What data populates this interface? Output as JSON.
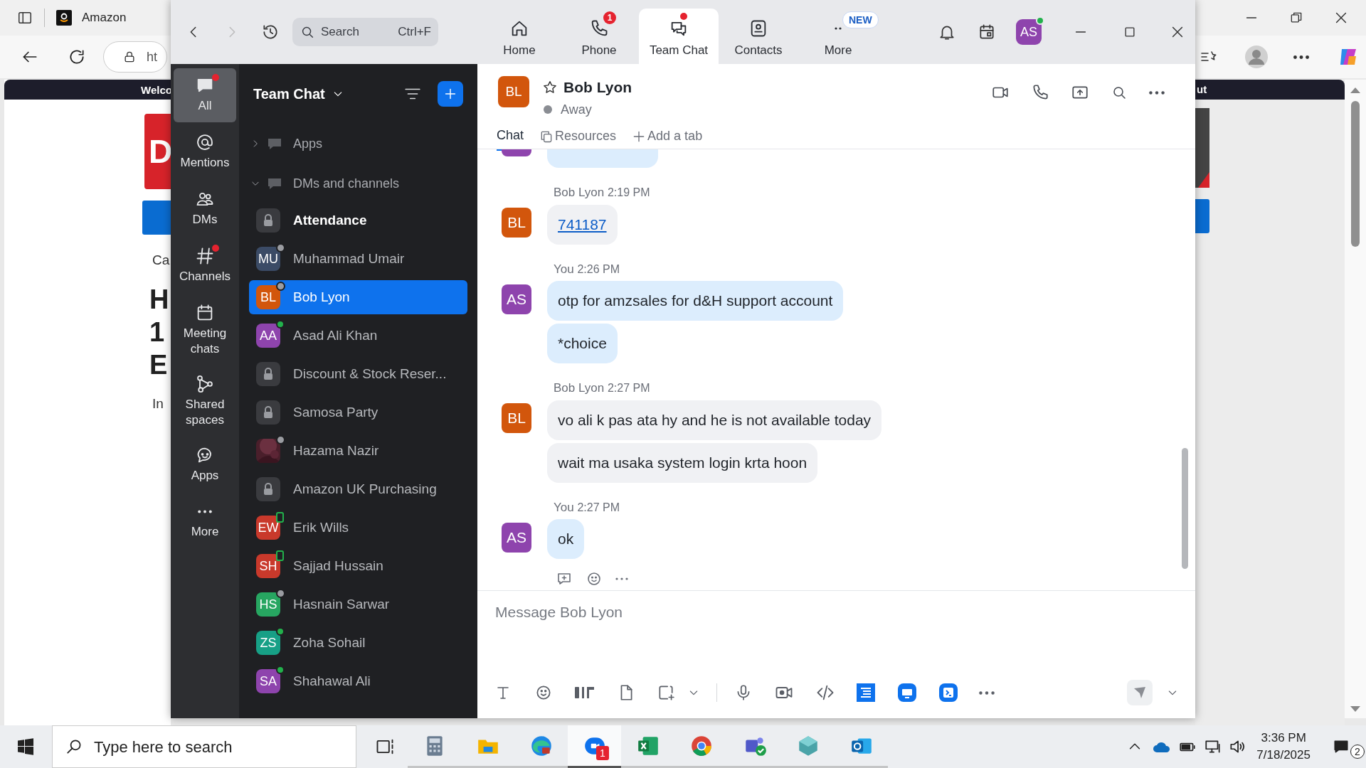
{
  "browser": {
    "tab_title": "Amazon",
    "address": "ht",
    "banner_left": "Welco",
    "banner_right": "ut",
    "logo_letter": "D",
    "fragments": [
      {
        "text": "Ca",
        "kind": "small"
      },
      {
        "text": "H",
        "kind": "heading"
      },
      {
        "text": "1",
        "kind": "heading"
      },
      {
        "text": "E",
        "kind": "heading"
      },
      {
        "text": "In",
        "kind": "small"
      }
    ]
  },
  "zoom": {
    "search": {
      "placeholder": "Search",
      "shortcut": "Ctrl+F"
    },
    "top_tabs": [
      {
        "label": "Home",
        "kind": "home",
        "selected": false,
        "unread_dot": false
      },
      {
        "label": "Phone",
        "kind": "phone",
        "selected": false,
        "unread_dot": false,
        "badge": "1"
      },
      {
        "label": "Team Chat",
        "kind": "chat",
        "selected": true,
        "unread_dot": true
      },
      {
        "label": "Contacts",
        "kind": "contacts",
        "selected": false,
        "unread_dot": false
      },
      {
        "label": "More",
        "kind": "more",
        "selected": false,
        "unread_dot": false,
        "badge": "NEW"
      }
    ],
    "account": {
      "initials": "AS",
      "color": "#8e44ad",
      "presence": {
        "kind": "online"
      }
    },
    "rail": [
      {
        "label": "All",
        "kind": "all",
        "selected": true,
        "unread_dot": true
      },
      {
        "label": "Mentions",
        "kind": "mentions",
        "selected": false,
        "unread_dot": false
      },
      {
        "label": "DMs",
        "kind": "dms",
        "selected": false,
        "unread_dot": false
      },
      {
        "label": "Channels",
        "kind": "channels",
        "selected": false,
        "unread_dot": true
      },
      {
        "label": "Meeting chats",
        "kind": "meetings",
        "selected": false,
        "unread_dot": false
      },
      {
        "label": "Shared spaces",
        "kind": "shared",
        "selected": false,
        "unread_dot": false
      },
      {
        "label": "Apps",
        "kind": "apps",
        "selected": false,
        "unread_dot": false
      },
      {
        "label": "More",
        "kind": "more",
        "selected": false,
        "unread_dot": false
      }
    ],
    "list": {
      "title": "Team Chat",
      "sections": [
        {
          "label": "Apps",
          "expanded": false
        },
        {
          "label": "DMs and channels",
          "expanded": true,
          "children": [
            {
              "name": "Attendance",
              "kind": "channel",
              "unread": true,
              "selected": false
            },
            {
              "name": "Muhammad Umair",
              "kind": "person",
              "initials": "MU",
              "color": "#3b4b66",
              "presence": {
                "kind": "away"
              },
              "unread": false,
              "selected": false
            },
            {
              "name": "Bob Lyon",
              "kind": "person",
              "initials": "BL",
              "color": "#d2560c",
              "presence": {
                "kind": "away"
              },
              "unread": false,
              "selected": true
            },
            {
              "name": "Asad Ali Khan",
              "kind": "person",
              "initials": "AA",
              "color": "#8e44ad",
              "presence": {
                "kind": "online"
              },
              "unread": false,
              "selected": false
            },
            {
              "name": "Discount & Stock Reser...",
              "kind": "channel",
              "unread": false,
              "selected": false
            },
            {
              "name": "Samosa Party",
              "kind": "channel",
              "unread": false,
              "selected": false
            },
            {
              "name": "Hazama Nazir",
              "presence": {
                "kind": "away"
              },
              "unread": false,
              "selected": false
            },
            {
              "name": "Amazon UK Purchasing",
              "kind": "channel",
              "unread": false,
              "selected": false
            },
            {
              "name": "Erik Wills",
              "kind": "person",
              "initials": "EW",
              "color": "#c9392b",
              "presence": {
                "kind": "mobile"
              },
              "unread": false,
              "selected": false
            },
            {
              "name": "Sajjad Hussain",
              "kind": "person",
              "initials": "SH",
              "color": "#c9392b",
              "presence": {
                "kind": "mobile"
              },
              "unread": false,
              "selected": false
            },
            {
              "name": "Hasnain Sarwar",
              "kind": "person",
              "initials": "HS",
              "color": "#27a661",
              "presence": {
                "kind": "away"
              },
              "unread": false,
              "selected": false
            },
            {
              "name": "Zoha Sohail",
              "kind": "person",
              "initials": "ZS",
              "color": "#17a086",
              "presence": {
                "kind": "online"
              },
              "unread": false,
              "selected": false
            },
            {
              "name": "Shahawal Ali",
              "kind": "person",
              "initials": "SA",
              "color": "#8e44ad",
              "presence": {
                "kind": "online"
              },
              "unread": false,
              "selected": false
            }
          ]
        }
      ]
    },
    "chat": {
      "name": "Bob Lyon",
      "initials": "BL",
      "color": "#d2560c",
      "status": "Away",
      "starred": false,
      "tabs": [
        {
          "label": "Chat",
          "kind": "chat",
          "selected": true
        },
        {
          "label": "Resources",
          "kind": "resources",
          "selected": false
        }
      ],
      "add_tab": "Add a tab",
      "messages": [
        {
          "sender": "Bob Lyon",
          "time": "2:19 PM",
          "mine": false,
          "initials": "BL",
          "color": "#d2560c",
          "bubbles": [
            {
              "text": "741187",
              "kind": "link"
            }
          ]
        },
        {
          "sender": "You",
          "time": "2:26 PM",
          "mine": true,
          "initials": "AS",
          "color": "#8e44ad",
          "bubbles": [
            {
              "text": "otp for amzsales for d&H support account",
              "kind": "text"
            },
            {
              "text": "*choice",
              "kind": "text"
            }
          ]
        },
        {
          "sender": "Bob Lyon",
          "time": "2:27 PM",
          "mine": false,
          "initials": "BL",
          "color": "#d2560c",
          "bubbles": [
            {
              "text": "vo ali k pas ata hy and he is not available today",
              "kind": "text"
            },
            {
              "text": "wait ma usaka system login krta hoon",
              "kind": "text"
            }
          ]
        },
        {
          "sender": "You",
          "time": "2:27 PM",
          "mine": true,
          "initials": "AS",
          "color": "#8e44ad",
          "bubbles": [
            {
              "text": "ok",
              "kind": "text"
            }
          ]
        }
      ],
      "composer": {
        "placeholder": "Message Bob Lyon"
      }
    }
  },
  "taskbar": {
    "search_placeholder": "Type here to search",
    "apps": [
      {
        "kind": "calculator",
        "active": false
      },
      {
        "kind": "explorer",
        "active": false
      },
      {
        "kind": "edge",
        "active": false
      },
      {
        "kind": "zoom",
        "active": true,
        "badge": "1"
      },
      {
        "kind": "excel",
        "active": false
      },
      {
        "kind": "chrome",
        "active": false
      },
      {
        "kind": "teams",
        "active": false
      },
      {
        "kind": "gem",
        "active": false
      },
      {
        "kind": "outlook",
        "active": false
      }
    ],
    "time": "3:36 PM",
    "date": "7/18/2025",
    "notifications": "2"
  }
}
